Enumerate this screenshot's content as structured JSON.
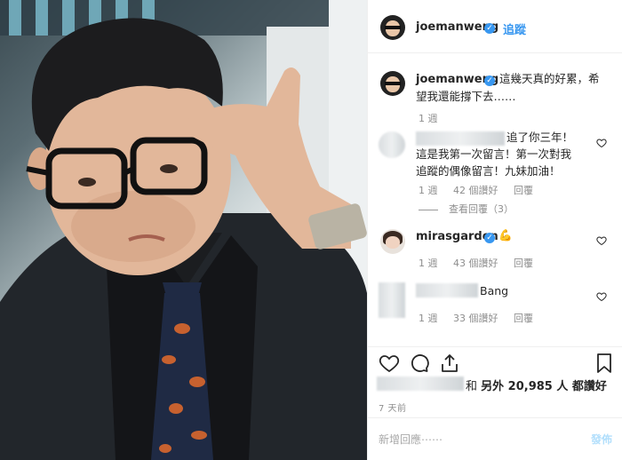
{
  "header": {
    "username": "joemanweng",
    "follow_label": "追蹤"
  },
  "caption": {
    "username": "joemanweng",
    "text_line1": "這幾天真的好累，希",
    "text_line2": "望我還能撐下去……",
    "time": "1 週"
  },
  "comments": [
    {
      "username_hidden": true,
      "text_line1": "追了你三年！",
      "text_line2": "這是我第一次留言！第一次對我",
      "text_line3": "追蹤的偶像留言！九妹加油！",
      "time": "1 週",
      "likes": "42 個讚好",
      "reply": "回覆",
      "view_replies": "查看回覆（3）"
    },
    {
      "username": "mirasgarden",
      "emoji": "💪",
      "time": "1 週",
      "likes": "43 個讚好",
      "reply": "回覆"
    },
    {
      "username_hidden": true,
      "text": "Bang",
      "time": "1 週",
      "likes": "33 個讚好",
      "reply": "回覆"
    }
  ],
  "likes_line": {
    "joiner": "和",
    "rest": "另外 20,985 人 都讚好"
  },
  "posted_time": "7 天前",
  "add_comment": {
    "placeholder": "新增回應⋯⋯",
    "post_label": "發佈"
  },
  "colors": {
    "accent": "#3897f0",
    "muted": "#8e8e8e",
    "tie": "#1f2a44",
    "paisley": "#c7612f"
  }
}
